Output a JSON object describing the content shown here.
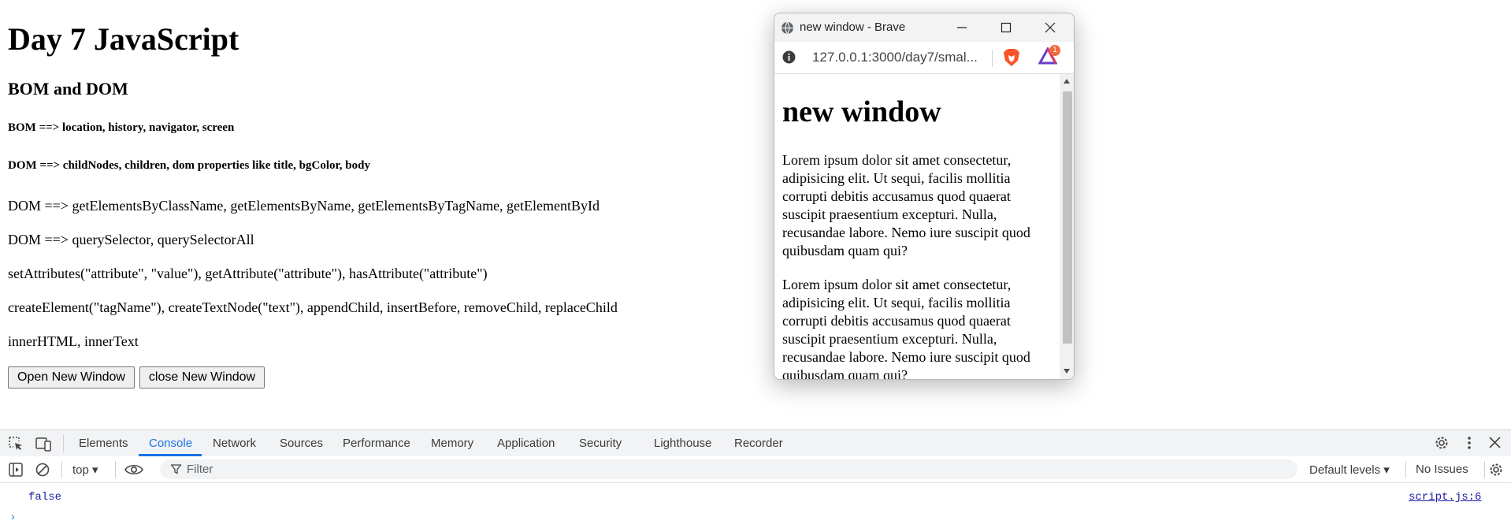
{
  "page": {
    "title": "Day 7 JavaScript",
    "subtitle": "BOM and DOM",
    "bom_line": "BOM ==> location, history, navigator, screen",
    "dom_line": "DOM ==> childNodes, children, dom properties like title, bgColor, body",
    "lines": [
      "DOM ==> getElementsByClassName, getElementsByName, getElementsByTagName, getElementById",
      "DOM ==> querySelector, querySelectorAll",
      "setAttributes(\"attribute\", \"value\"), getAttribute(\"attribute\"), hasAttribute(\"attribute\")",
      "createElement(\"tagName\"), createTextNode(\"text\"), appendChild, insertBefore, removeChild, replaceChild",
      "innerHTML, innerText"
    ],
    "buttons": {
      "open": "Open New Window",
      "close": "close New Window"
    }
  },
  "popup": {
    "window_title": "new window - Brave",
    "url": "127.0.0.1:3000/day7/smal...",
    "rewards_badge": "1",
    "heading": "new window",
    "paragraphs": [
      "Lorem ipsum dolor sit amet consectetur, adipisicing elit. Ut sequi, facilis mollitia corrupti debitis accusamus quod quaerat suscipit praesentium excepturi. Nulla, recusandae labore. Nemo iure suscipit quod quibusdam quam qui?",
      "Lorem ipsum dolor sit amet consectetur, adipisicing elit. Ut sequi, facilis mollitia corrupti debitis accusamus quod quaerat suscipit praesentium excepturi. Nulla, recusandae labore. Nemo iure suscipit quod quibusdam quam qui?"
    ]
  },
  "devtools": {
    "tabs": [
      "Elements",
      "Console",
      "Network",
      "Sources",
      "Performance",
      "Memory",
      "Application",
      "Security",
      "Lighthouse",
      "Recorder"
    ],
    "active_tab": "Console",
    "context": "top",
    "filter_placeholder": "Filter",
    "levels": "Default levels",
    "issues": "No Issues",
    "log": {
      "value": "false",
      "source": "script.js:6"
    },
    "accent_color": "#1a73e8"
  }
}
